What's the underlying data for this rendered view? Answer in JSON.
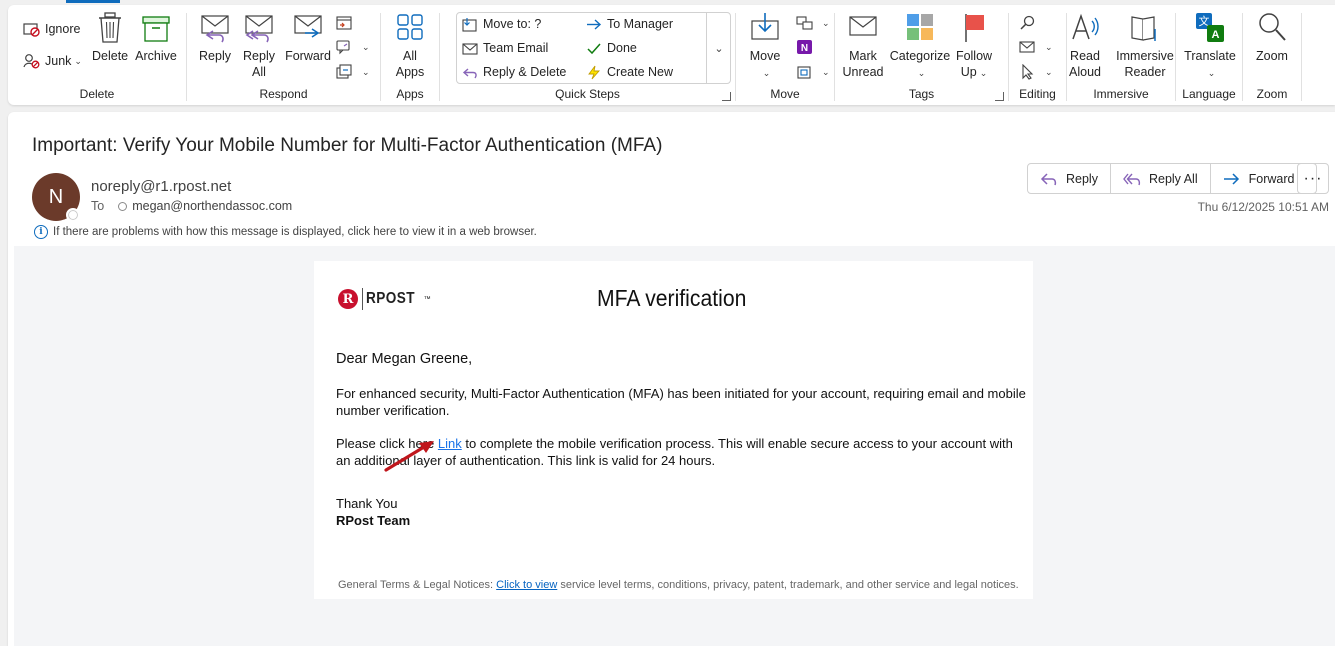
{
  "ribbon": {
    "delete_group": {
      "ignore": "Ignore",
      "junk": "Junk",
      "delete": "Delete",
      "archive": "Archive",
      "label": "Delete"
    },
    "respond_group": {
      "reply": "Reply",
      "reply_all_1": "Reply",
      "reply_all_2": "All",
      "forward": "Forward",
      "label": "Respond"
    },
    "apps_group": {
      "all_apps_1": "All",
      "all_apps_2": "Apps",
      "label": "Apps"
    },
    "quick_steps": {
      "move_to": "Move to: ?",
      "team_email": "Team Email",
      "reply_delete": "Reply & Delete",
      "to_manager": "To Manager",
      "done": "Done",
      "create_new": "Create New",
      "label": "Quick Steps"
    },
    "move_group": {
      "move": "Move",
      "label": "Move"
    },
    "tags_group": {
      "mark_unread_1": "Mark",
      "mark_unread_2": "Unread",
      "categorize": "Categorize",
      "follow_up_1": "Follow",
      "follow_up_2": "Up",
      "label": "Tags"
    },
    "editing_group": {
      "label": "Editing"
    },
    "immersive_group": {
      "read_aloud_1": "Read",
      "read_aloud_2": "Aloud",
      "immersive_reader_1": "Immersive",
      "immersive_reader_2": "Reader",
      "label": "Immersive"
    },
    "language_group": {
      "translate": "Translate",
      "label": "Language"
    },
    "zoom_group": {
      "zoom": "Zoom",
      "label": "Zoom"
    }
  },
  "message": {
    "subject": "Important: Verify Your Mobile Number for Multi-Factor Authentication (MFA)",
    "avatar_initial": "N",
    "sender": "noreply@r1.rpost.net",
    "to_label": "To",
    "recipient": "megan@northendassoc.com",
    "info_bar": "If there are problems with how this message is displayed, click here to view it in a web browser.",
    "actions": {
      "reply": "Reply",
      "reply_all": "Reply All",
      "forward": "Forward",
      "more": "···"
    },
    "date": "Thu 6/12/2025 10:51 AM"
  },
  "email_body": {
    "logo_text": "RPOST",
    "logo_r": "R",
    "title": "MFA verification",
    "greeting": "Dear Megan Greene,",
    "paragraph1": "For enhanced security, Multi-Factor Authentication (MFA) has been initiated for your account, requiring email and mobile number verification.",
    "paragraph2_before": "Please click here ",
    "paragraph2_link": "Link",
    "paragraph2_after": " to complete the mobile verification process. This will enable secure access to your account with an additional layer of authentication. This link is valid for 24 hours.",
    "thanks": "Thank You",
    "team": "RPost Team",
    "legal_before": "General Terms & Legal Notices: ",
    "legal_link": "Click to view",
    "legal_after": " service level terms, conditions, privacy, patent, trademark, and other service and legal notices."
  },
  "colors": {
    "accent": "#0f6cbd",
    "avatar": "#6b3a2a",
    "annotation_arrow": "#c0161c",
    "brand_red": "#c8102e"
  }
}
